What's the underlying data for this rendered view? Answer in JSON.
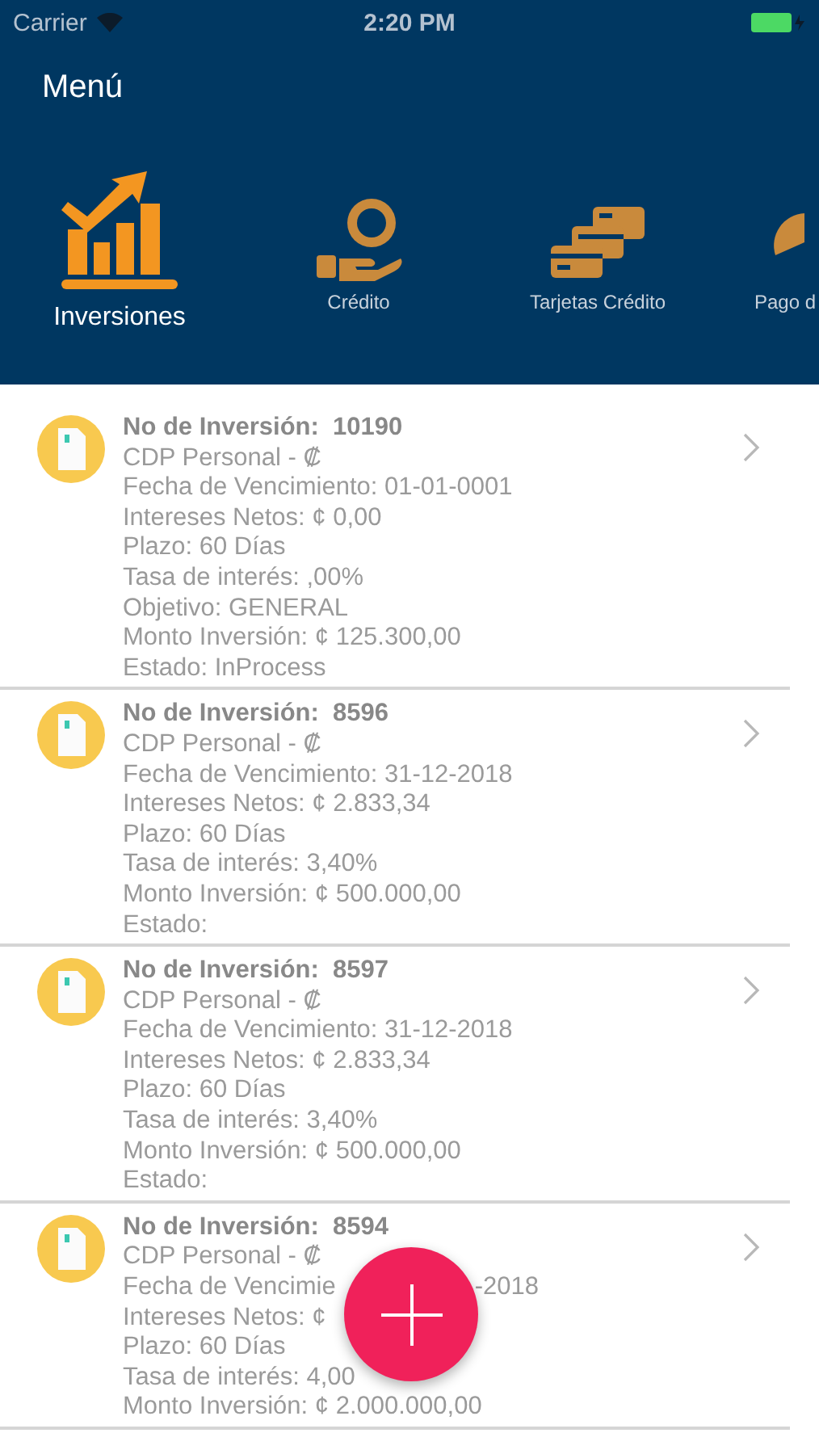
{
  "status_bar": {
    "carrier": "Carrier",
    "time": "2:20 PM"
  },
  "header": {
    "title": "Menú"
  },
  "menu_items": [
    {
      "label": "Inversiones",
      "kind": "chart",
      "selected": true
    },
    {
      "label": "Crédito",
      "kind": "coin",
      "selected": false
    },
    {
      "label": "Tarjetas Crédito",
      "kind": "cards",
      "selected": false
    },
    {
      "label": "Pago d",
      "kind": "pie",
      "selected": false
    }
  ],
  "investments": [
    {
      "title": "No de Inversión:  10190",
      "lines": [
        {
          "text": "CDP Personal - ₡"
        },
        {
          "text": "Fecha de Vencimiento:  01-01-0001"
        },
        {
          "text": "Intereses Netos:  ¢ 0,00"
        },
        {
          "text": "Plazo:  60  Días"
        },
        {
          "text": "Tasa de interés:  ,00%"
        },
        {
          "text": "Objetivo:  GENERAL"
        },
        {
          "text": "Monto Inversión:  ¢ 125.300,00"
        },
        {
          "text": "Estado:  InProcess"
        }
      ]
    },
    {
      "title": "No de Inversión:  8596",
      "lines": [
        {
          "text": "CDP Personal - ₡"
        },
        {
          "text": "Fecha de Vencimiento:  31-12-2018"
        },
        {
          "text": "Intereses Netos:  ¢ 2.833,34"
        },
        {
          "text": "Plazo:  60  Días"
        },
        {
          "text": "Tasa de interés:  3,40%"
        },
        {
          "text": "Monto Inversión:  ¢ 500.000,00"
        },
        {
          "text": "Estado:"
        }
      ]
    },
    {
      "title": "No de Inversión:  8597",
      "lines": [
        {
          "text": "CDP Personal - ₡"
        },
        {
          "text": "Fecha de Vencimiento:  31-12-2018"
        },
        {
          "text": "Intereses Netos:  ¢ 2.833,34"
        },
        {
          "text": "Plazo:  60  Días"
        },
        {
          "text": "Tasa de interés:  3,40%"
        },
        {
          "text": "Monto Inversión:  ¢ 500.000,00"
        },
        {
          "text": "Estado:"
        }
      ]
    },
    {
      "title": "No de Inversión:  8594",
      "lines": [
        {
          "text": "CDP Personal - ₡"
        },
        {
          "text": "Fecha de Vencimie",
          "tail": "-2018"
        },
        {
          "text": "Intereses Netos:  ¢"
        },
        {
          "text": "Plazo:  60  Días"
        },
        {
          "text": "Tasa de interés:  4,00"
        },
        {
          "text": "Monto Inversión:  ¢ 2.000.000,00"
        }
      ]
    }
  ]
}
